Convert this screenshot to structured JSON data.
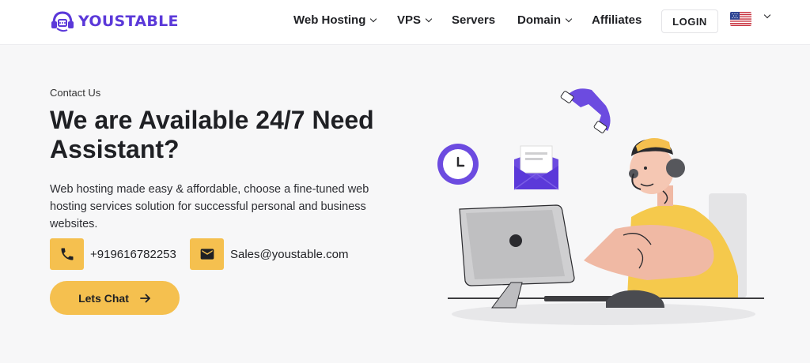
{
  "header": {
    "logo_text": "YOUSTABLE",
    "nav": [
      {
        "label": "Web Hosting",
        "has_dropdown": true
      },
      {
        "label": "VPS",
        "has_dropdown": true
      },
      {
        "label": "Servers",
        "has_dropdown": false
      },
      {
        "label": "Domain",
        "has_dropdown": true
      },
      {
        "label": "Affiliates",
        "has_dropdown": false
      }
    ],
    "login_label": "LOGIN",
    "language_flag": "us-flag-icon"
  },
  "hero": {
    "eyebrow": "Contact Us",
    "title": "We are Available 24/7 Need Assistant?",
    "description": "Web hosting made easy & affordable, choose a fine-tuned web hosting services solution for successful personal and business websites.",
    "phone": "+919616782253",
    "email": "Sales@youstable.com",
    "chat_label": "Lets Chat",
    "chat_icon": "arrow-right-icon"
  },
  "colors": {
    "brand": "#5b39d9",
    "accent": "#f5c04f",
    "text": "#1f2024"
  }
}
